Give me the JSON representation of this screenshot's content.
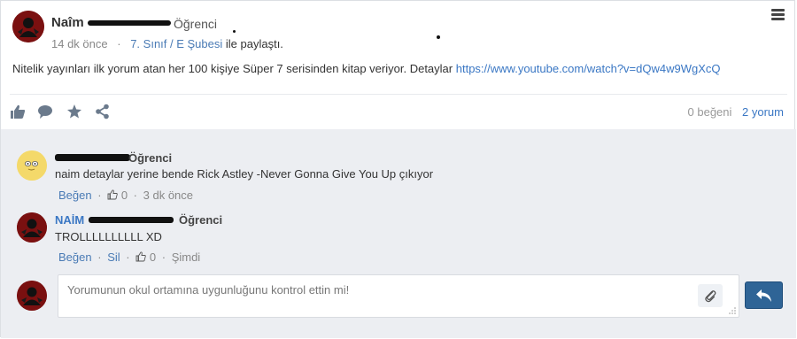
{
  "post": {
    "author_first_name": "Naîm",
    "author_role": "Öğrenci",
    "time_ago": "14 dk önce",
    "separator": "·",
    "class_link": "7. Sınıf / E Şubesi",
    "shared_text": "ile paylaştı.",
    "body_text": "Nitelik yayınları ilk yorum atan her 100 kişiye Süper 7 serisinden kitap veriyor. Detaylar",
    "body_url": "https://www.youtube.com/watch?v=dQw4w9WgXcQ",
    "likes_count": "0 beğeni",
    "comments_count": "2 yorum",
    "icons": [
      "menu-icon",
      "like-icon",
      "comment-icon",
      "star-icon",
      "share-icon"
    ]
  },
  "comments": [
    {
      "author_role": "Öğrenci",
      "text": "naim detaylar yerine bende Rick Astley -Never Gonna Give You Up çıkıyor",
      "like_label": "Beğen",
      "like_count": "0",
      "time": "3 dk önce",
      "name_color": "#333333"
    },
    {
      "author_name": "NAİM",
      "author_role": "Öğrenci",
      "text": "TROLLLLLLLLLL XD",
      "like_label": "Beğen",
      "delete_label": "Sil",
      "like_count": "0",
      "time": "Şimdi",
      "name_color": "#3a77c4"
    }
  ],
  "reply": {
    "placeholder": "Yorumunun okul ortamına uygunluğunu kontrol ettin mi!"
  },
  "colors": {
    "accent": "#3a77c4",
    "send_button": "#2f6496",
    "comments_bg": "#eceef2"
  }
}
